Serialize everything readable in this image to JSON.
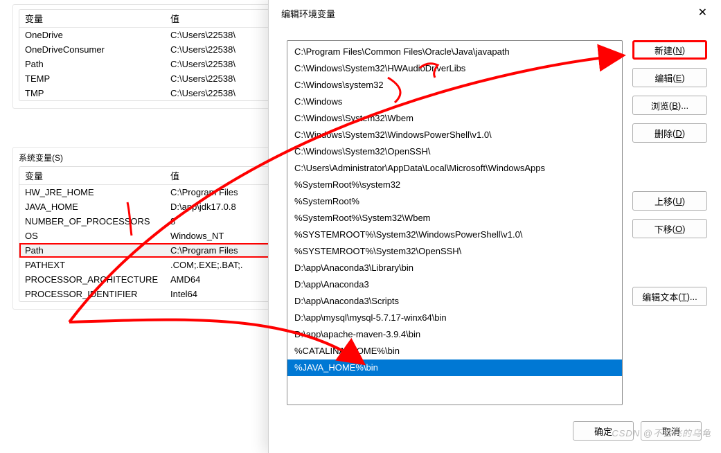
{
  "headers": {
    "variable": "变量",
    "value": "值"
  },
  "user_vars_title": "",
  "user_vars": [
    {
      "name": "OneDrive",
      "value": "C:\\Users\\22538\\"
    },
    {
      "name": "OneDriveConsumer",
      "value": "C:\\Users\\22538\\"
    },
    {
      "name": "Path",
      "value": "C:\\Users\\22538\\"
    },
    {
      "name": "TEMP",
      "value": "C:\\Users\\22538\\"
    },
    {
      "name": "TMP",
      "value": "C:\\Users\\22538\\"
    }
  ],
  "sys_vars_title": "系统变量(S)",
  "sys_vars": [
    {
      "name": "HW_JRE_HOME",
      "value": "C:\\Program Files"
    },
    {
      "name": "JAVA_HOME",
      "value": "D:\\app\\jdk17.0.8"
    },
    {
      "name": "NUMBER_OF_PROCESSORS",
      "value": "8"
    },
    {
      "name": "OS",
      "value": "Windows_NT"
    },
    {
      "name": "Path",
      "value": "C:\\Program Files",
      "selected": true,
      "path_hl": true
    },
    {
      "name": "PATHEXT",
      "value": ".COM;.EXE;.BAT;."
    },
    {
      "name": "PROCESSOR_ARCHITECTURE",
      "value": "AMD64"
    },
    {
      "name": "PROCESSOR_IDENTIFIER",
      "value": "Intel64"
    }
  ],
  "modal": {
    "title": "编辑环境变量",
    "path_entries": [
      "C:\\Program Files\\Common Files\\Oracle\\Java\\javapath",
      "C:\\Windows\\System32\\HWAudioDriverLibs",
      "C:\\Windows\\system32",
      "C:\\Windows",
      "C:\\Windows\\System32\\Wbem",
      "C:\\Windows\\System32\\WindowsPowerShell\\v1.0\\",
      "C:\\Windows\\System32\\OpenSSH\\",
      "C:\\Users\\Administrator\\AppData\\Local\\Microsoft\\WindowsApps",
      "%SystemRoot%\\system32",
      "%SystemRoot%",
      "%SystemRoot%\\System32\\Wbem",
      "%SYSTEMROOT%\\System32\\WindowsPowerShell\\v1.0\\",
      "%SYSTEMROOT%\\System32\\OpenSSH\\",
      "D:\\app\\Anaconda3\\Library\\bin",
      "D:\\app\\Anaconda3",
      "D:\\app\\Anaconda3\\Scripts",
      "D:\\app\\mysql\\mysql-5.7.17-winx64\\bin",
      "D:\\app\\apache-maven-3.9.4\\bin",
      "%CATALINA_HOME%\\bin",
      "%JAVA_HOME%\\bin"
    ],
    "selected_index": 19,
    "buttons": {
      "new": {
        "label": "新建",
        "accel": "N"
      },
      "edit": {
        "label": "编辑",
        "accel": "E"
      },
      "browse": {
        "label": "浏览",
        "accel": "B",
        "trail": "..."
      },
      "delete": {
        "label": "删除",
        "accel": "D"
      },
      "move_up": {
        "label": "上移",
        "accel": "U"
      },
      "move_down": {
        "label": "下移",
        "accel": "O"
      },
      "edit_text": {
        "label": "编辑文本",
        "accel": "T",
        "trail": "..."
      },
      "ok": {
        "label": "确定"
      },
      "cancel": {
        "label": "取消"
      }
    }
  },
  "watermark": "CSDN @不会飞的乌龟"
}
